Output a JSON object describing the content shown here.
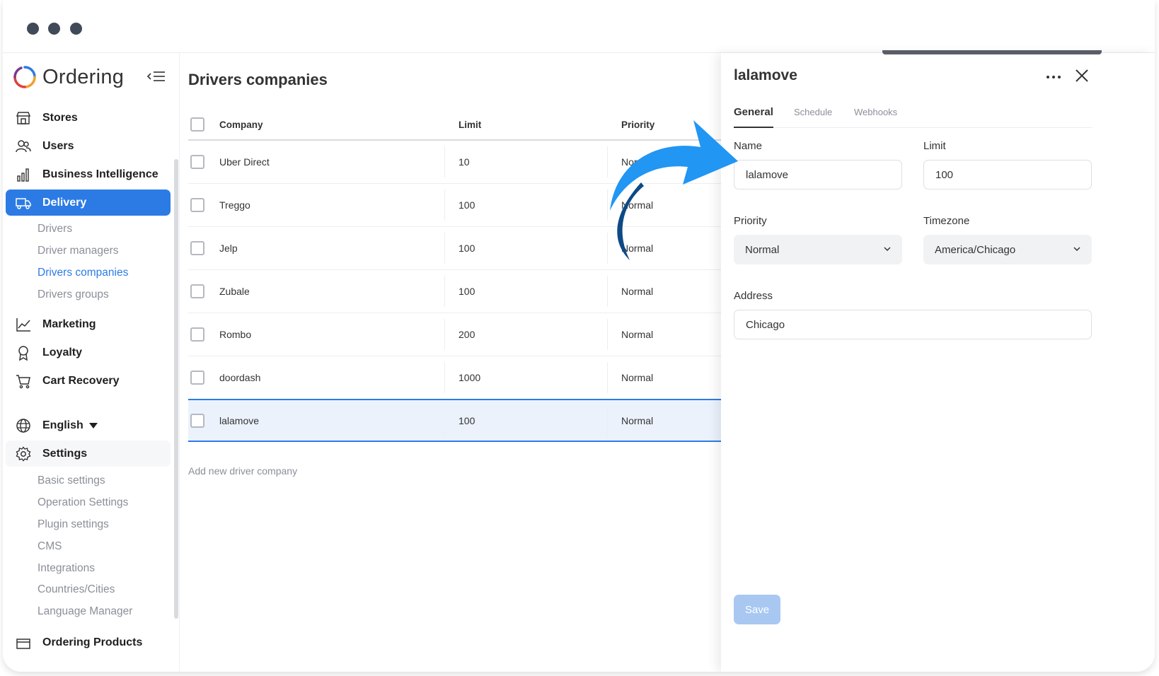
{
  "sidebar": {
    "brand": "Ordering",
    "nav": [
      {
        "label": "Stores"
      },
      {
        "label": "Users"
      },
      {
        "label": "Business Intelligence"
      },
      {
        "label": "Delivery"
      }
    ],
    "delivery_sub": [
      "Drivers",
      "Driver managers",
      "Drivers companies",
      "Drivers groups"
    ],
    "nav2": [
      {
        "label": "Marketing"
      },
      {
        "label": "Loyalty"
      },
      {
        "label": "Cart Recovery"
      }
    ],
    "language": "English",
    "settings": "Settings",
    "settings_sub": [
      "Basic settings",
      "Operation Settings",
      "Plugin settings",
      "CMS",
      "Integrations",
      "Countries/Cities",
      "Language Manager"
    ],
    "bottom_item": "Ordering Products"
  },
  "main": {
    "title": "Drivers companies",
    "columns": {
      "company": "Company",
      "limit": "Limit",
      "priority": "Priority"
    },
    "rows": [
      {
        "company": "Uber Direct",
        "limit": "10",
        "priority": "Normal"
      },
      {
        "company": "Treggo",
        "limit": "100",
        "priority": "Normal"
      },
      {
        "company": "Jelp",
        "limit": "100",
        "priority": "Normal"
      },
      {
        "company": "Zubale",
        "limit": "100",
        "priority": "Normal"
      },
      {
        "company": "Rombo",
        "limit": "200",
        "priority": "Normal"
      },
      {
        "company": "doordash",
        "limit": "1000",
        "priority": "Normal"
      },
      {
        "company": "lalamove",
        "limit": "100",
        "priority": "Normal"
      }
    ],
    "add_link": "Add new driver company"
  },
  "drawer": {
    "title": "lalamove",
    "tabs": [
      "General",
      "Schedule",
      "Webhooks"
    ],
    "name_label": "Name",
    "name_value": "lalamove",
    "limit_label": "Limit",
    "limit_value": "100",
    "priority_label": "Priority",
    "priority_value": "Normal",
    "timezone_label": "Timezone",
    "timezone_value": "America/Chicago",
    "address_label": "Address",
    "address_value": "Chicago",
    "save_label": "Save"
  },
  "colors": {
    "accent": "#2c7be5",
    "arrow": "#2196f3",
    "arrow_dark": "#0d4a86",
    "selected_row": "#ebf2fc",
    "save_disabled": "#a8c8f2"
  }
}
